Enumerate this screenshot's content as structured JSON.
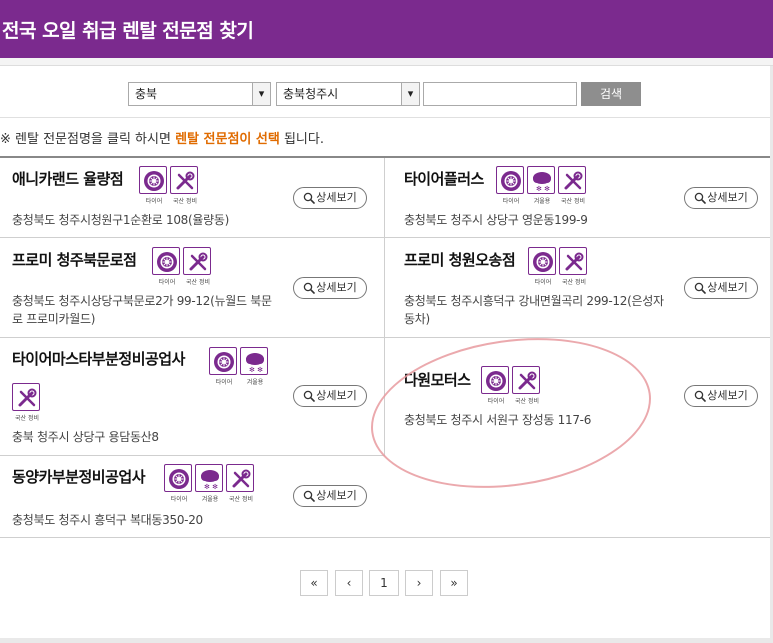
{
  "header": {
    "title": "전국 오일 취급 렌탈 전문점 찾기"
  },
  "search": {
    "province": "충북",
    "city": "충북청주시",
    "keyword": "",
    "button_label": "검색",
    "arrow": "▾"
  },
  "notice": {
    "prefix": "※ 렌탈 전문점명을 클릭 하시면 ",
    "highlight": "렌탈 전문점이 선택",
    "suffix": " 됩니다."
  },
  "detail_label": "상세보기",
  "badge_captions": {
    "tire": "타이어",
    "winter": "겨울용",
    "repair": "국산 정비"
  },
  "shops": [
    {
      "name": "애니카랜드 율량점",
      "address": "충청북도 청주시청원구1순환로 108(율량동)"
    },
    {
      "name": "타이어플러스",
      "address": "충청북도 청주시 상당구 영운동199-9"
    },
    {
      "name": "프로미 청주북문로점",
      "address": "충청북도 청주시상당구북문로2가 99-12(뉴월드 북문로 프로미카월드)"
    },
    {
      "name": "프로미 청원오송점",
      "address": "충청북도 청주시흥덕구 강내면월곡리 299-12(은성자동차)"
    },
    {
      "name": "타이어마스타부분정비공업사",
      "address": "충북 청주시 상당구 용담동산8"
    },
    {
      "name": "다원모터스",
      "address": "충청북도 청주시 서원구 장성동 117-6"
    },
    {
      "name": "동양카부분정비공업사",
      "address": "충청북도 청주시 흥덕구 복대동350-20"
    }
  ],
  "pagination": {
    "first": "«",
    "prev": "‹",
    "current": "1",
    "next": "›",
    "last": "»"
  },
  "colors": {
    "brand": "#7b2a8e",
    "highlight": "#e06b00",
    "annotation": "#e79a9f"
  }
}
